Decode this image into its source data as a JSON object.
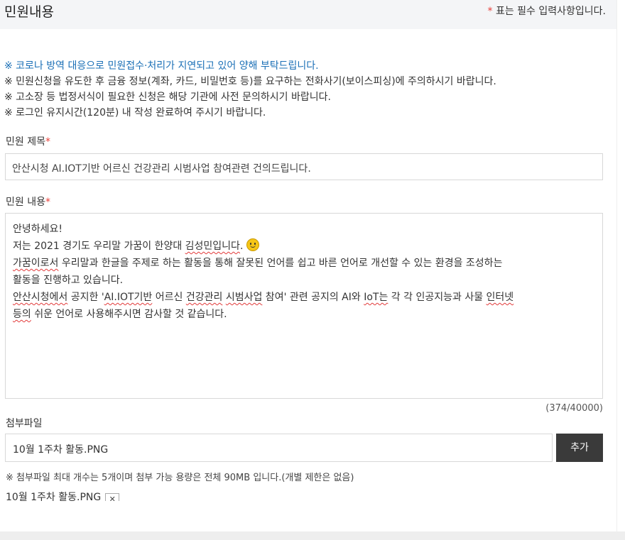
{
  "header": {
    "title": "민원내용",
    "required_star": "*",
    "required_note": " 표는 필수 입력사항입니다."
  },
  "notices": [
    "※ 코로나 방역 대응으로 민원접수·처리가 지연되고 있어 양해 부탁드립니다.",
    "※ 민원신청을 유도한 후 금융 정보(계좌, 카드, 비밀번호 등)를 요구하는 전화사기(보이스피싱)에 주의하시기 바랍니다.",
    "※ 고소장 등 법정서식이 필요한 신청은 해당 기관에 사전 문의하시기 바랍니다.",
    "※ 로그인 유지시간(120분) 내 작성 완료하여 주시기 바랍니다."
  ],
  "subject": {
    "label": "민원 제목",
    "star": "*",
    "value": "안산시청 AI.IOT기반 어르신 건강관리 시범사업 참여관련 건의드립니다."
  },
  "content": {
    "label": "민원 내용",
    "star": "*",
    "line1": "안녕하세요!",
    "line2_a": "저는 2021 경기도 우리말 가꿈이 한양대 ",
    "line2_b": "김성민입니다",
    "line2_c": ". ",
    "line3_a": "가꿈이로서",
    "line3_b": " 우리말과 한글을 주제로 하는 활동을 통해 잘못된 언어를 쉽고 바른 언어로 개선할 수 있는 환경을 조성하는",
    "line4": "활동을 진행하고 있습니다.",
    "line5_a": "안산시청에서",
    "line5_b": " 공지한 '",
    "line5_c": "AI.IOT기반",
    "line5_d": " 어르신 ",
    "line5_e": "건강관리",
    "line5_f": " ",
    "line5_g": "시범사업",
    "line5_h": " 참여' 관련 공지의 AI와 ",
    "line5_i": "IoT는",
    "line5_j": " 각 각 인공지능과 사물 ",
    "line5_k": "인터넷",
    "line6_a": "등의",
    "line6_b": " 쉬운 언어로 사용해주시면 감사할 것 같습니다.",
    "counter": "(374/40000)"
  },
  "attachment": {
    "label": "첨부파일",
    "file_value": "10월 1주차 활동.PNG",
    "add_label": "추가",
    "note": "※ 첨부파일 최대 개수는 5개이며 첨부 가능 용량은 전체 90MB 입니다.(개별 제한은 없음)",
    "attached_file": "10월 1주차 활동.PNG",
    "remove_symbol": "✕"
  },
  "colors": {
    "accent_blue": "#1a6fb6",
    "required_red": "#e8403a",
    "button_dark": "#3a3a3a"
  }
}
